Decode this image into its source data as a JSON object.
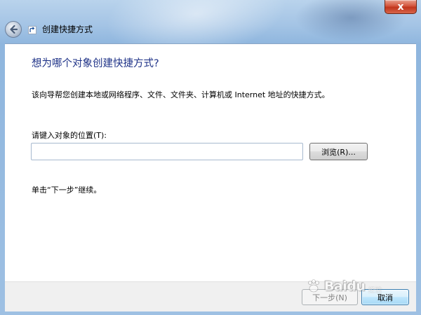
{
  "window": {
    "title": "创建快捷方式",
    "close_glyph": "x"
  },
  "main": {
    "heading": "想为哪个对象创建快捷方式?",
    "description": "该向导帮您创建本地或网络程序、文件、文件夹、计算机或 Internet 地址的快捷方式。",
    "field_label": "请键入对象的位置(T):",
    "location_value": "",
    "browse_label": "浏览(R)...",
    "continue_hint": "单击“下一步”继续。"
  },
  "footer": {
    "next_label": "下一步(N)",
    "cancel_label": "取消"
  },
  "watermark": {
    "text": "Baidu",
    "sub": "经验"
  },
  "colors": {
    "heading": "#1e3287",
    "close_button": "#c0351c",
    "cancel_highlight": "#bee6fd"
  }
}
